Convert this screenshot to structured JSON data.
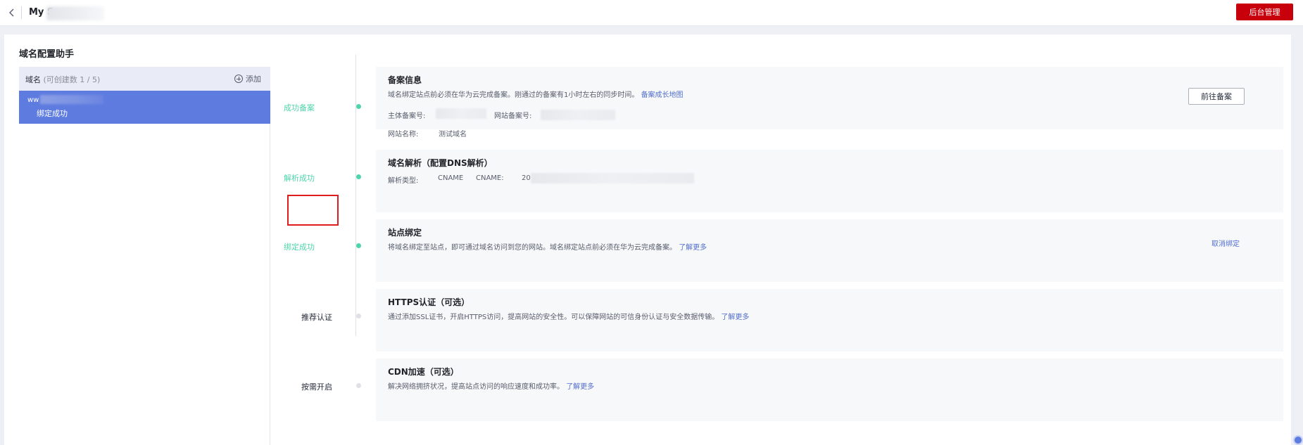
{
  "header": {
    "app_title": "My S",
    "admin_button": "后台管理"
  },
  "main": {
    "title": "域名配置助手"
  },
  "domains": {
    "header_label": "域名",
    "header_count": "(可创建数 1 / 5)",
    "add_label": "添加",
    "item": {
      "name_prefix": "ww",
      "status": "绑定成功"
    }
  },
  "steps": [
    {
      "label": "成功备案",
      "state": "done"
    },
    {
      "label": "解析成功",
      "state": "done"
    },
    {
      "label": "绑定成功",
      "state": "done"
    },
    {
      "label": "推荐认证",
      "state": "todo"
    },
    {
      "label": "按需开启",
      "state": "todo"
    }
  ],
  "cards": {
    "icp": {
      "title": "备案信息",
      "desc": "域名绑定站点前必须在华为云完成备案。刚通过的备案有1小时左右的同步时间。",
      "link": "备案成长地图",
      "subject_label": "主体备案号:",
      "site_label": "网站备案号:",
      "site_name_label": "网站名称:",
      "site_name_value": "测试域名",
      "button": "前往备案"
    },
    "dns": {
      "title": "域名解析（配置DNS解析）",
      "type_label": "解析类型:",
      "type_value": "CNAME",
      "cname_label": "CNAME:",
      "cname_value_prefix": "20"
    },
    "bind": {
      "title": "站点绑定",
      "desc": "将域名绑定至站点，即可通过域名访问到您的网站。域名绑定站点前必须在华为云完成备案。",
      "link": "了解更多",
      "unbind": "取消绑定"
    },
    "https": {
      "title": "HTTPS认证（可选）",
      "desc": "通过添加SSL证书，开启HTTPS访问，提高网站的安全性。可以保障网站的可信身份认证与安全数据传输。",
      "link": "了解更多"
    },
    "cdn": {
      "title": "CDN加速（可选）",
      "desc": "解决网络拥挤状况，提高站点访问的响应速度和成功率。",
      "link": "了解更多"
    }
  },
  "colors": {
    "brand_red": "#c7000b",
    "selected_blue": "#5e7ce0",
    "success_green": "#50d4ab",
    "link_blue": "#526ecc",
    "highlight_red": "#e01c1c"
  }
}
